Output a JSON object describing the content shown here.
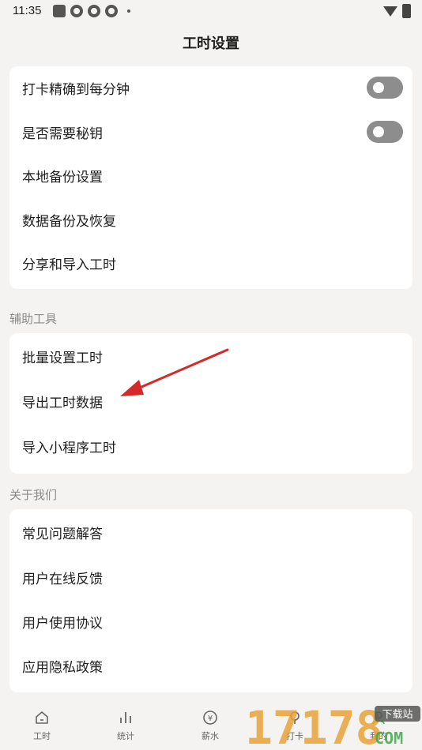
{
  "status": {
    "time": "11:35"
  },
  "header": {
    "title": "工时设置"
  },
  "settings_top": [
    {
      "label": "打卡精确到每分钟",
      "toggle": false
    },
    {
      "label": "是否需要秘钥",
      "toggle": false
    },
    {
      "label": "本地备份设置"
    },
    {
      "label": "数据备份及恢复"
    },
    {
      "label": "分享和导入工时"
    }
  ],
  "tools": {
    "section_label": "辅助工具",
    "items": [
      "批量设置工时",
      "导出工时数据",
      "导入小程序工时"
    ]
  },
  "about": {
    "section_label": "关于我们",
    "items": [
      "常见问题解答",
      "用户在线反馈",
      "用户使用协议",
      "应用隐私政策"
    ]
  },
  "tabbar": {
    "items": [
      "工时",
      "统计",
      "薪水",
      "打卡",
      "我的"
    ]
  },
  "watermark": {
    "text": "17178",
    "sub": "下载站",
    "domain": "COM"
  },
  "colors": {
    "arrow": "#d42a2a",
    "toggle_off": "#8d8d8d"
  }
}
